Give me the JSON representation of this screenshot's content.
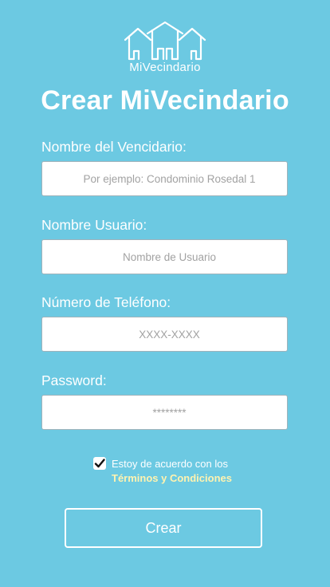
{
  "brand": {
    "logo_icon": "houses-icon",
    "logo_text": "MiVecindario"
  },
  "title": "Crear MiVecindario",
  "form": {
    "neighborhood": {
      "label": "Nombre del Vencidario:",
      "placeholder": "Por ejemplo: Condominio Rosedal 1",
      "value": ""
    },
    "username": {
      "label": "Nombre Usuario:",
      "placeholder": "Nombre de Usuario",
      "value": ""
    },
    "phone": {
      "label": "Número de Teléfono:",
      "placeholder": "XXXX-XXXX",
      "value": ""
    },
    "password": {
      "label": "Password:",
      "placeholder": "********",
      "value": ""
    }
  },
  "agreement": {
    "checked": true,
    "text": "Estoy de acuerdo con los",
    "link": "Términos y Condiciones"
  },
  "submit_label": "Crear",
  "colors": {
    "background": "#6cc9e2",
    "link": "#fff3b0",
    "field_border": "#9fb3bb"
  }
}
